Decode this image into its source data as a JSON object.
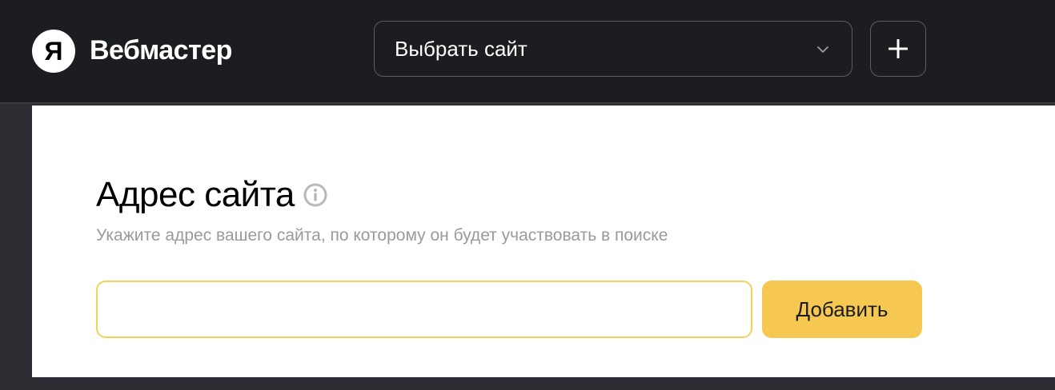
{
  "header": {
    "logo_letter": "Я",
    "app_title": "Вебмастер",
    "site_select": {
      "selected": "Выбрать сайт",
      "icon": "chevron-down-icon"
    },
    "add_button_icon": "plus-icon"
  },
  "main": {
    "title": "Адрес сайта",
    "title_icon": "info-icon",
    "subtitle": "Укажите адрес вашего сайта, по которому он будет участвовать в поиске",
    "url_input": {
      "value": "",
      "placeholder": ""
    },
    "add_button_label": "Добавить"
  },
  "colors": {
    "header_bg": "#1b1d20",
    "page_bg": "#2c2e33",
    "accent_yellow": "#f6c852",
    "input_border": "#f0d35a",
    "muted_text": "#9a9a9a"
  }
}
